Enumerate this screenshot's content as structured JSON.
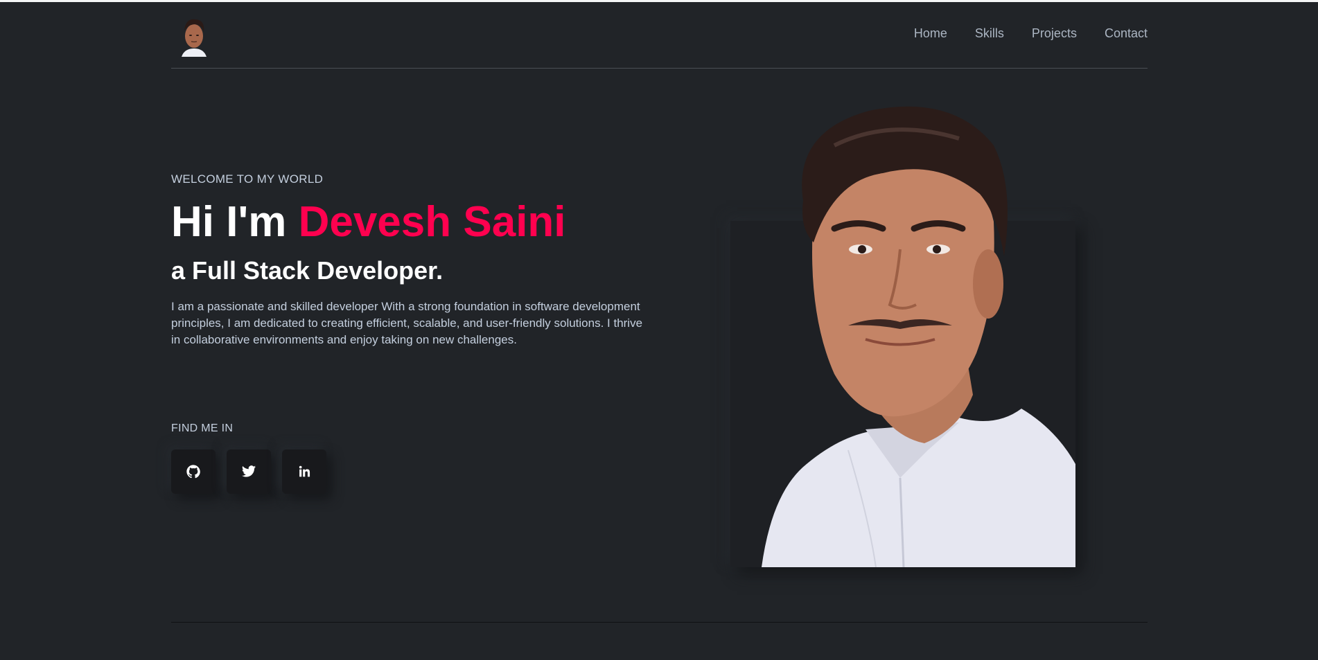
{
  "header": {
    "logo_alt": "Profile avatar",
    "nav": [
      {
        "label": "Home"
      },
      {
        "label": "Skills"
      },
      {
        "label": "Projects"
      },
      {
        "label": "Contact"
      }
    ]
  },
  "hero": {
    "welcome": "WELCOME TO MY WORLD",
    "title_prefix": "Hi I'm ",
    "title_name": "Devesh Saini",
    "subtitle": "a Full Stack Developer.",
    "description": "I am a passionate and skilled developer With a strong foundation in software development principles, I am dedicated to creating efficient, scalable, and user-friendly solutions. I thrive in collaborative environments and enjoy taking on new challenges.",
    "find_me_label": "FIND ME IN",
    "socials": [
      {
        "icon": "github-icon"
      },
      {
        "icon": "twitter-icon"
      },
      {
        "icon": "linkedin-icon"
      }
    ]
  },
  "colors": {
    "background": "#212428",
    "accent": "#ff014f",
    "text": "#c4cfde",
    "heading": "#ffffff"
  }
}
